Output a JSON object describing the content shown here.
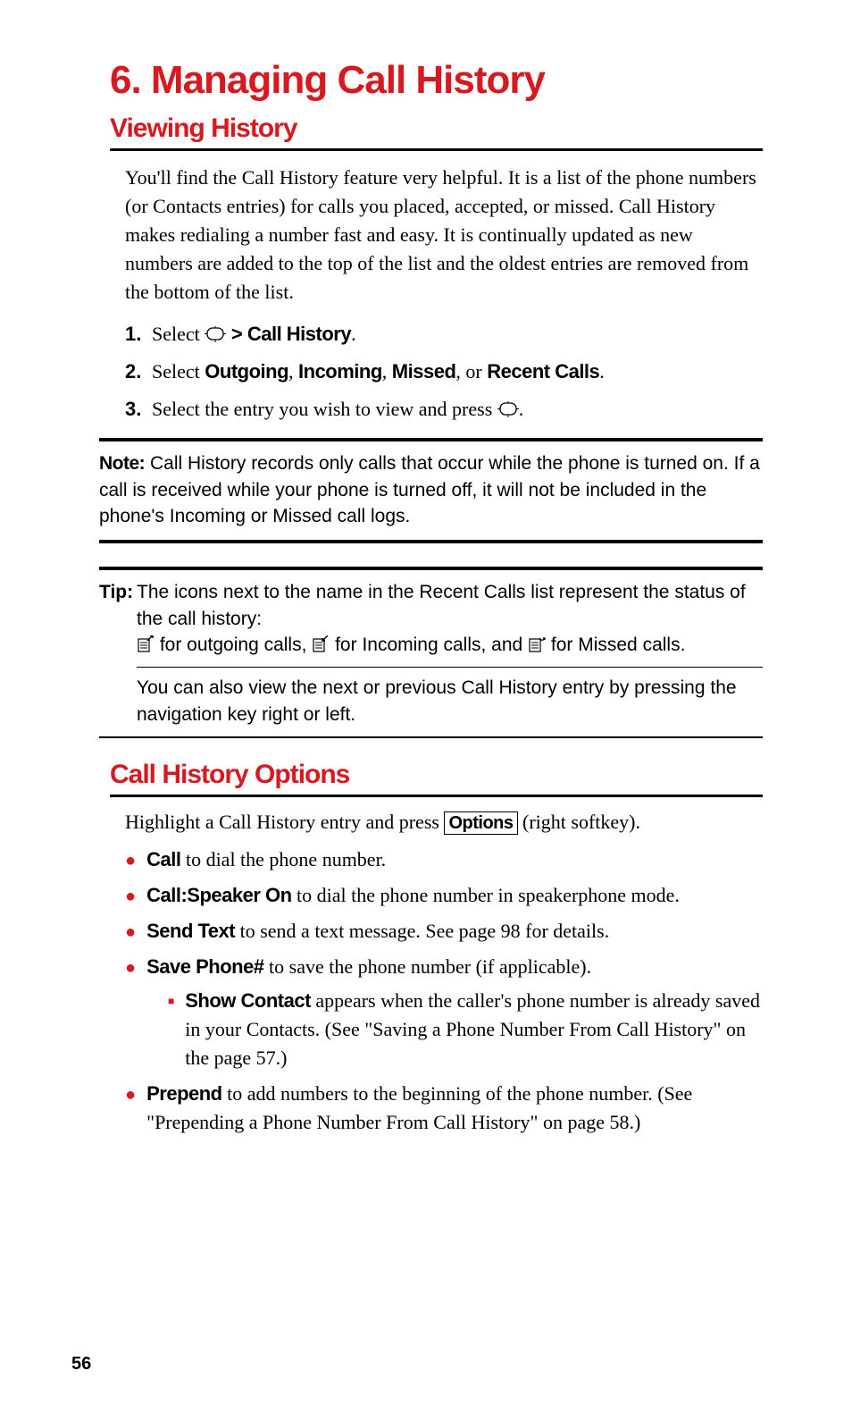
{
  "chapter_title": "6. Managing Call History",
  "sections": {
    "s1": {
      "heading": "Viewing History",
      "intro": "You'll find the Call History feature very helpful. It is a list of the phone numbers (or Contacts entries) for calls you placed, accepted, or missed. Call History makes redialing a number fast and easy. It is continually updated as new numbers are added to the top of the list and the oldest entries are removed from the bottom of the list.",
      "steps": [
        {
          "num": "1.",
          "pre": "Select ",
          "bold": " > Call History",
          "post": "."
        },
        {
          "num": "2.",
          "pre": "Select ",
          "b1": "Outgoing",
          "c1": ", ",
          "b2": "Incoming",
          "c2": ", ",
          "b3": "Missed",
          "c3": ", or ",
          "b4": "Recent Calls",
          "post": "."
        },
        {
          "num": "3.",
          "pre": "Select the entry you wish to view and press ",
          "post": "."
        }
      ]
    },
    "note": {
      "label": "Note:",
      "text": " Call History records only calls that occur while the phone is turned on. If a call is received while your phone is turned off, it will not be included in the phone's Incoming or Missed call logs."
    },
    "tip": {
      "label": "Tip:",
      "line1": "The icons next to the name in the Recent Calls list represent the status of the call history:",
      "icons": {
        "outgoing": " for outgoing calls, ",
        "incoming": " for Incoming calls, and ",
        "missed": " for Missed calls."
      },
      "line2": "You can also view the next or previous Call History entry by pressing the navigation key right or left."
    },
    "s2": {
      "heading": "Call History Options",
      "intro_pre": "Highlight a Call History entry and press ",
      "intro_btn": "Options",
      "intro_post": " (right softkey).",
      "bullets": [
        {
          "b": "Call",
          "t": " to dial the phone number."
        },
        {
          "b": "Call:Speaker On",
          "t": " to dial the phone number in speakerphone mode."
        },
        {
          "b": "Send Text",
          "t": " to send a text message. See page 98 for details."
        },
        {
          "b": "Save Phone#",
          "t": " to save the phone number (if applicable).",
          "sub": [
            {
              "b": "Show Contact",
              "t": " appears when the caller's phone number is already saved in your Contacts. (See \"Saving a Phone Number From Call History\" on the page 57.)"
            }
          ]
        },
        {
          "b": "Prepend",
          "t": " to add numbers to the beginning of the phone number. (See \"Prepending a Phone Number From Call History\" on page 58.)"
        }
      ]
    }
  },
  "page_number": "56"
}
